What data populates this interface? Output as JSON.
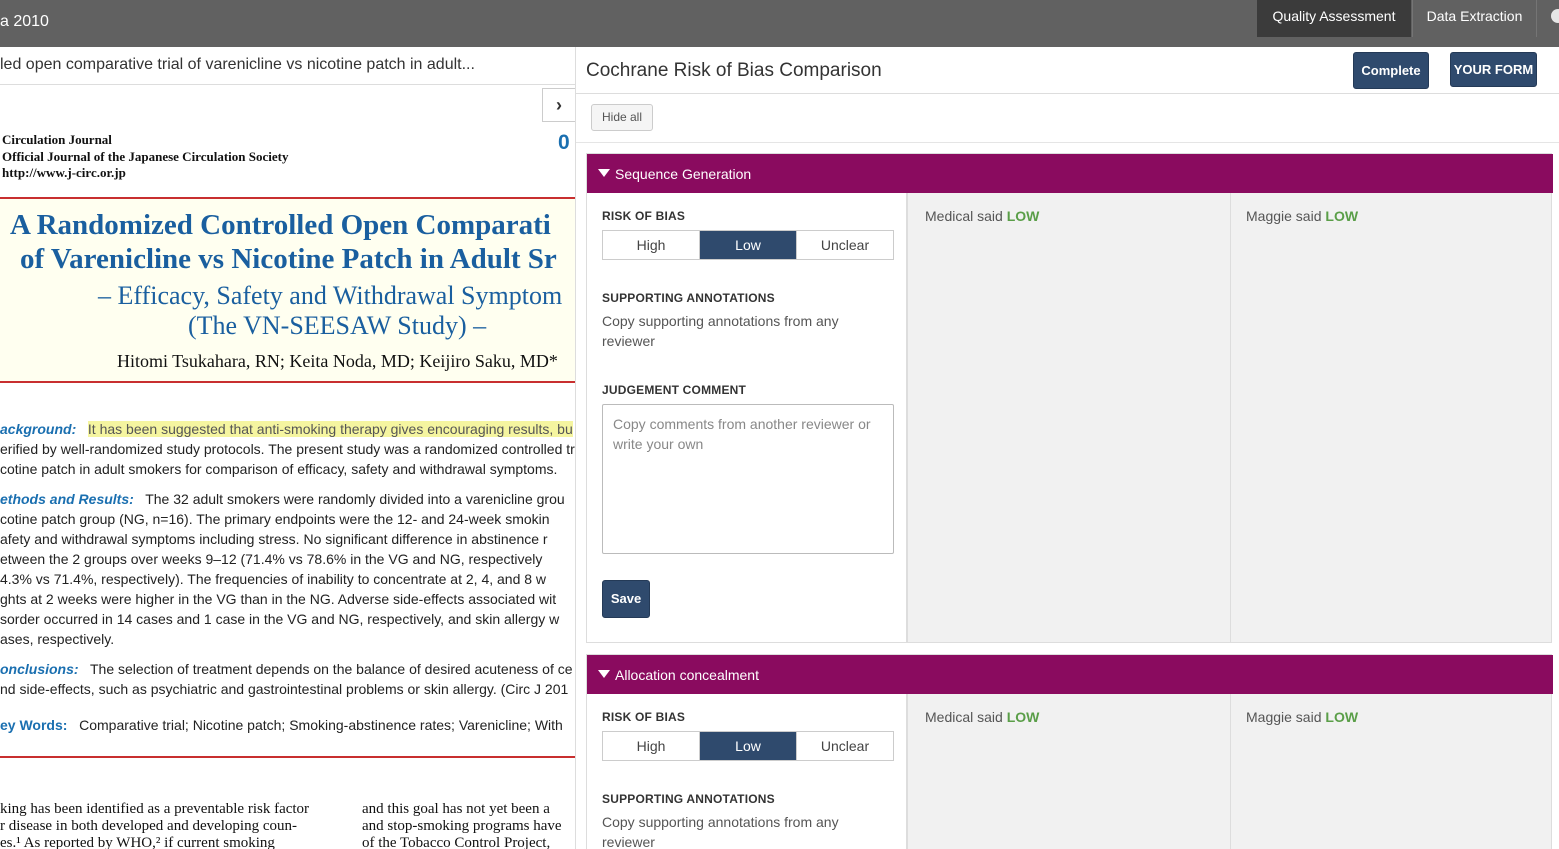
{
  "topbar": {
    "title": "a 2010",
    "tabs": [
      "Quality Assessment",
      "Data Extraction"
    ]
  },
  "document": {
    "title": "led open comparative trial of varenicline vs nicotine patch in adult...",
    "journal": [
      "Circulation Journal",
      "Official Journal of the Japanese Circulation Society",
      "http://www.j-circ.or.jp"
    ],
    "page_number": "0",
    "article_title": [
      "A Randomized Controlled Open Comparati",
      "of Varenicline vs Nicotine Patch in Adult Sr",
      "– Efficacy, Safety and Withdrawal Symptom",
      "(The VN-SEESAW Study) –"
    ],
    "authors": "Hitomi Tsukahara, RN; Keita Noda, MD; Keijiro Saku, MD*",
    "background_label": "ackground:",
    "background_highlight": "It has been suggested that anti-smoking therapy gives encouraging results, bu",
    "background_lines": [
      "erified by well-randomized study protocols. The present study was a randomized controlled tr",
      "cotine patch in adult smokers for comparison of efficacy, safety and withdrawal symptoms."
    ],
    "methods_label": "ethods and Results:",
    "methods_first": "The 32 adult smokers were randomly divided into a varenicline grou",
    "methods_lines": [
      "cotine patch group (NG, n=16). The primary endpoints were the 12- and 24-week smokin",
      "afety and withdrawal symptoms including stress. No significant difference in abstinence r",
      "etween the 2 groups over weeks 9–12 (71.4% vs 78.6% in the VG and NG, respectively",
      "4.3% vs 71.4%, respectively). The frequencies of inability to concentrate at 2, 4, and 8 w",
      "ghts at 2 weeks were higher in the VG than in the NG. Adverse side-effects associated wit",
      "sorder occurred in 14 cases and 1 case in the VG and NG, respectively, and skin allergy w",
      "ases, respectively."
    ],
    "conclusions_label": "onclusions:",
    "conclusions_first": "The selection of treatment depends on the balance of desired acuteness of ce",
    "conclusions_second": "nd side-effects, such as psychiatric and gastrointestinal problems or skin allergy.    (Circ J 201",
    "keywords_label": "ey Words:",
    "keywords": "Comparative trial; Nicotine patch; Smoking-abstinence rates; Varenicline; With",
    "col1": [
      "king has been identified as a preventable risk factor",
      "r disease in both developed and developing coun-",
      "es.¹ As reported by WHO,² if current smoking"
    ],
    "col2": [
      "and this goal has not yet been a",
      "and stop-smoking programs have",
      "of the Tobacco Control Project,"
    ]
  },
  "panel": {
    "title": "Cochrane Risk of Bias Comparison",
    "complete_label": "Complete",
    "your_form_label": "YOUR FORM",
    "hide_all_label": "Hide all",
    "risk_label": "RISK OF BIAS",
    "options": [
      "High",
      "Low",
      "Unclear"
    ],
    "supporting_label": "SUPPORTING ANNOTATIONS",
    "supporting_hint": "Copy supporting annotations from any reviewer",
    "judgement_label": "JUDGEMENT COMMENT",
    "comment_placeholder": "Copy comments from another reviewer or write your own",
    "save_label": "Save",
    "sections": [
      {
        "name": "Sequence Generation",
        "selected": "Low",
        "reviewers": [
          {
            "who": "Medical said",
            "value": "LOW"
          },
          {
            "who": "Maggie said",
            "value": "LOW"
          }
        ]
      },
      {
        "name": "Allocation concealment",
        "selected": "Low",
        "reviewers": [
          {
            "who": "Medical said",
            "value": "LOW"
          },
          {
            "who": "Maggie said",
            "value": "LOW"
          }
        ]
      }
    ]
  },
  "colors": {
    "accent": "#8a0b5f",
    "button": "#2f4a6d",
    "low": "#5a9e48"
  }
}
